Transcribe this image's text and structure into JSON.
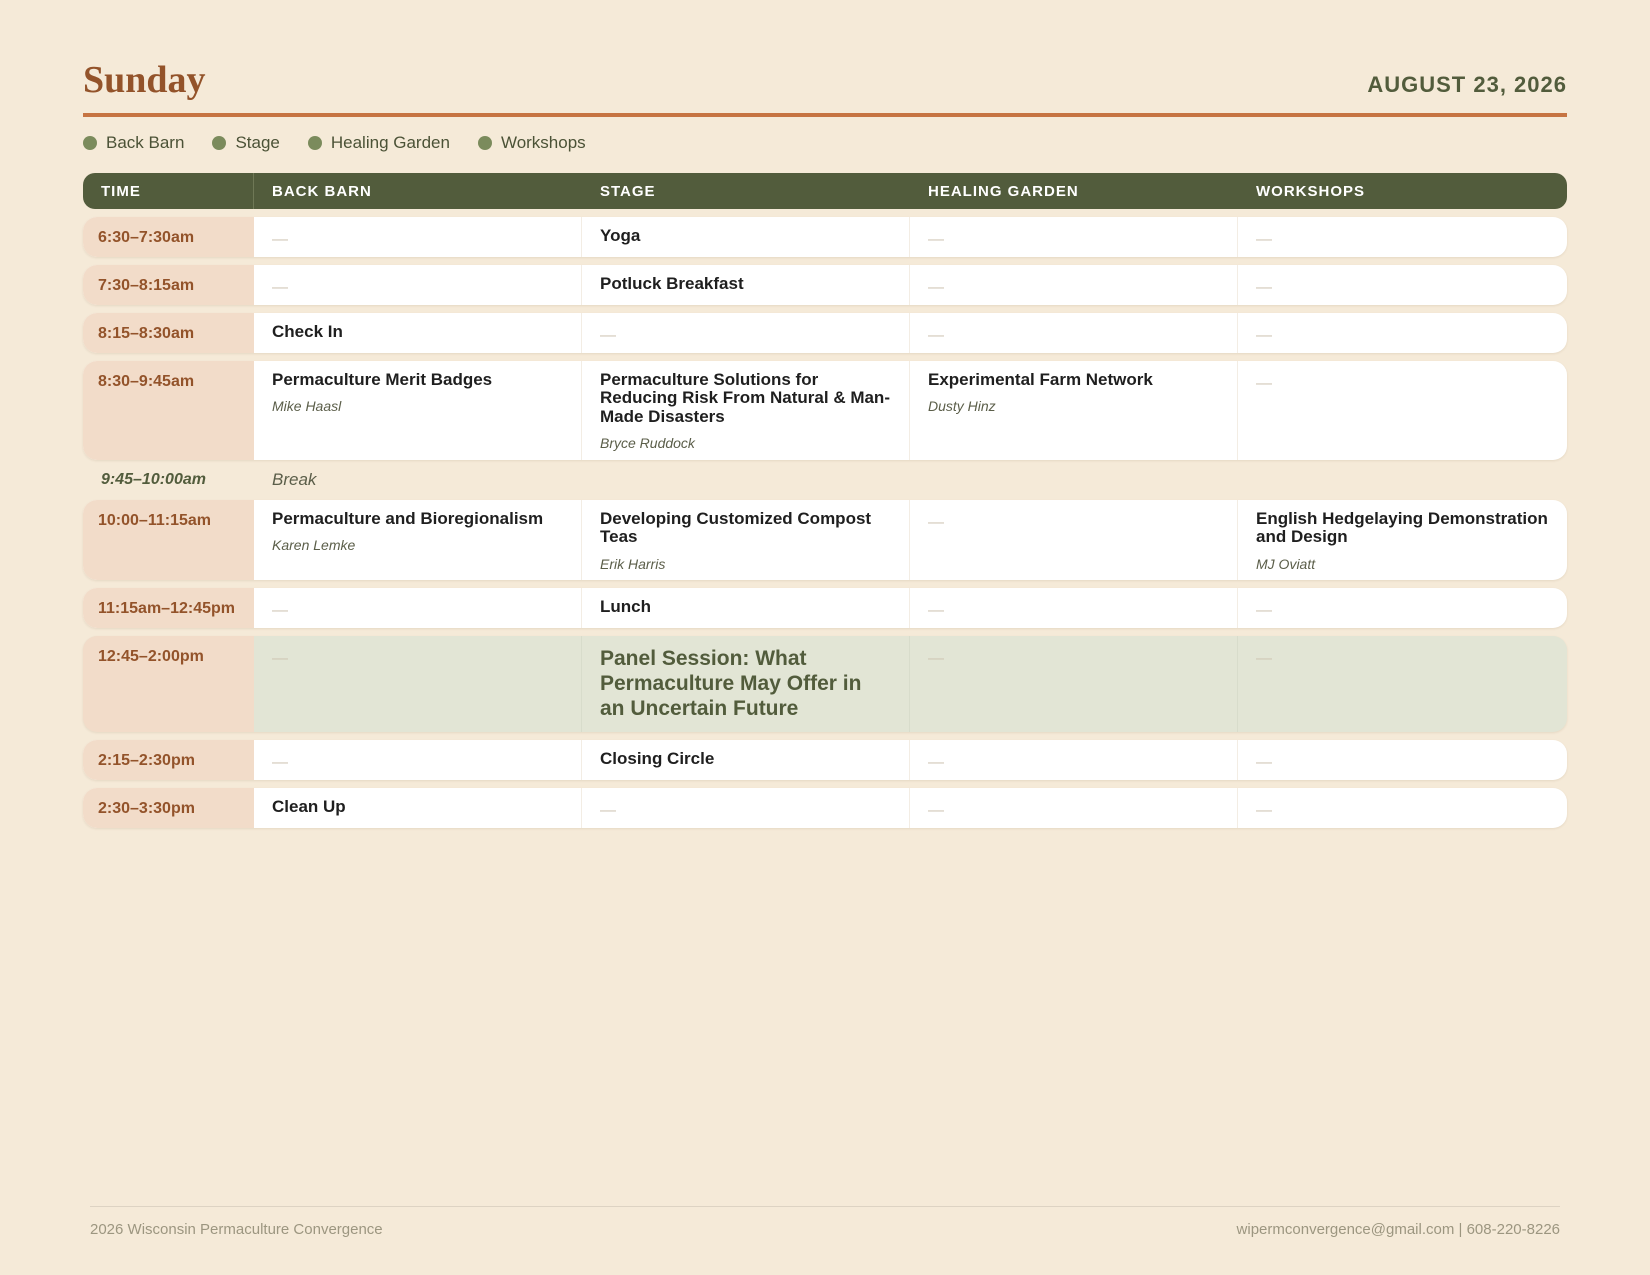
{
  "header": {
    "day": "Sunday",
    "date": "AUGUST 23, 2026"
  },
  "legend": [
    "Back Barn",
    "Stage",
    "Healing Garden",
    "Workshops"
  ],
  "columns": {
    "time": "TIME",
    "back_barn": "BACK BARN",
    "stage": "STAGE",
    "healing_garden": "HEALING GARDEN",
    "workshops": "WORKSHOPS"
  },
  "empty": "—",
  "rows": [
    {
      "time": "6:30–7:30am",
      "stage": {
        "title": "Yoga"
      }
    },
    {
      "time": "7:30–8:15am",
      "stage": {
        "title": "Potluck Breakfast"
      }
    },
    {
      "time": "8:15–8:30am",
      "back_barn": {
        "title": "Check In"
      }
    },
    {
      "time": "8:30–9:45am",
      "back_barn": {
        "title": "Permaculture Merit Badges",
        "speaker": "Mike Haasl"
      },
      "stage": {
        "title": "Permaculture Solutions for Reducing Risk From Natural & Man-Made Disasters",
        "speaker": "Bryce Ruddock"
      },
      "healing_garden": {
        "title": "Experimental Farm Network",
        "speaker": "Dusty Hinz"
      }
    },
    {
      "time": "10:00–11:15am",
      "back_barn": {
        "title": "Permaculture and Bioregionalism",
        "speaker": "Karen Lemke"
      },
      "stage": {
        "title": "Developing Customized Compost Teas",
        "speaker": "Erik Harris"
      },
      "workshops": {
        "title": "English Hedgelaying Demonstration and Design",
        "speaker": "MJ Oviatt"
      }
    },
    {
      "time": "11:15am–12:45pm",
      "stage": {
        "title": "Lunch"
      }
    },
    {
      "time": "12:45–2:00pm",
      "stage": {
        "title": "Panel Session: What Permaculture May Offer in an Uncertain Future"
      }
    },
    {
      "time": "2:15–2:30pm",
      "stage": {
        "title": "Closing Circle"
      }
    },
    {
      "time": "2:30–3:30pm",
      "back_barn": {
        "title": "Clean Up"
      }
    }
  ],
  "break": {
    "time": "9:45–10:00am",
    "label": "Break"
  },
  "footer": {
    "left": "2026 Wisconsin Permaculture Convergence",
    "right": "wipermconvergence@gmail.com  |  608-220-8226"
  }
}
